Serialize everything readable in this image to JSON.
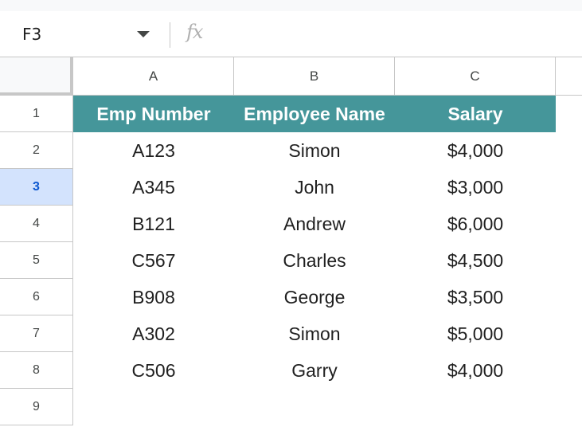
{
  "formula_bar": {
    "name_box": "F3",
    "fx_label": "fx",
    "formula_value": ""
  },
  "columns": [
    "A",
    "B",
    "C"
  ],
  "rows": [
    "1",
    "2",
    "3",
    "4",
    "5",
    "6",
    "7",
    "8",
    "9"
  ],
  "active_row": "3",
  "table": {
    "headers": [
      "Emp Number",
      "Employee Name",
      "Salary"
    ],
    "rows": [
      [
        "A123",
        "Simon",
        "$4,000"
      ],
      [
        "A345",
        "John",
        "$3,000"
      ],
      [
        "B121",
        "Andrew",
        "$6,000"
      ],
      [
        "C567",
        "Charles",
        "$4,500"
      ],
      [
        "B908",
        "George",
        "$3,500"
      ],
      [
        "A302",
        "Simon",
        "$5,000"
      ],
      [
        "C506",
        "Garry",
        "$4,000"
      ]
    ]
  },
  "colors": {
    "header_fill": "#45969a",
    "active_row_fill": "#d3e3fd",
    "active_row_text": "#0b57d0"
  }
}
